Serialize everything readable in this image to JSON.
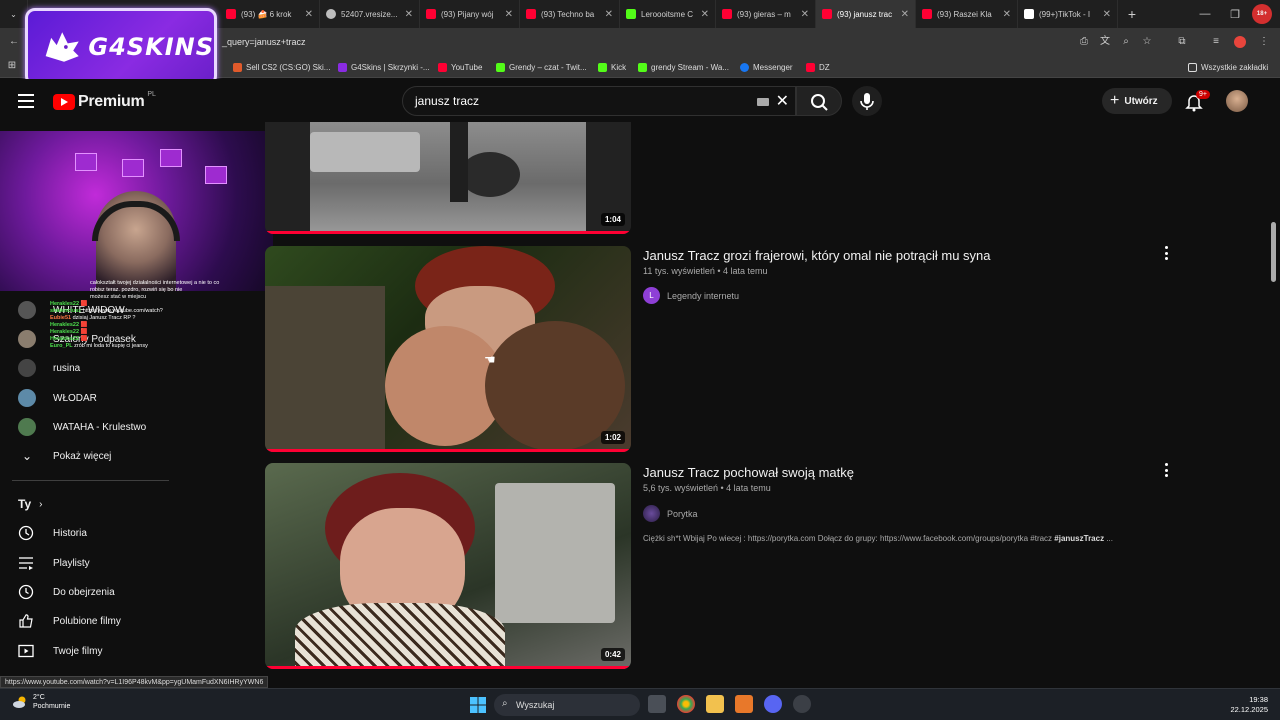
{
  "browser": {
    "tabs": [
      {
        "label": "(93) 🍰 6 krok",
        "color": "#ff0033"
      },
      {
        "label": "52407.vresize...",
        "color": "#bdbdbd"
      },
      {
        "label": "(93) Pijany wój",
        "color": "#ff0033"
      },
      {
        "label": "(93) Techno ba",
        "color": "#ff0033"
      },
      {
        "label": "Leroooitsme C",
        "color": "#53fc18"
      },
      {
        "label": "(93) gieras – m",
        "color": "#ff0033"
      },
      {
        "label": "(93) janusz trac",
        "color": "#ff0033",
        "active": true
      },
      {
        "label": "(93) Raszei Kla",
        "color": "#ff0033"
      },
      {
        "label": "(99+)TikTok - I",
        "color": "#ffffff"
      }
    ],
    "url": "_query=janusz+tracz",
    "bookmarks": [
      {
        "label": "Sell CS2 (CS:GO) Ski...",
        "color": "#e05a2b"
      },
      {
        "label": "G4Skins | Skrzynki -...",
        "color": "#8a2be2"
      },
      {
        "label": "YouTube",
        "color": "#ff0033"
      },
      {
        "label": "Grendy – czat - Twit...",
        "color": "#53fc18"
      },
      {
        "label": "Kick",
        "color": "#53fc18"
      },
      {
        "label": "grendy Stream - Wa...",
        "color": "#53fc18"
      },
      {
        "label": "Messenger",
        "color": "#1877f2"
      },
      {
        "label": "DZ",
        "color": "#ff0033"
      }
    ],
    "all_bookmarks": "Wszystkie zakładki",
    "status_url": "https://www.youtube.com/watch?v=L1I96P48kvM&pp=ygUMamFudXN6IHRyYWN6"
  },
  "overlay": {
    "brand": "G4SKINS",
    "accent": "#8a2be2"
  },
  "youtube": {
    "logo_text": "Premium",
    "logo_region": "PL",
    "search_query": "janusz tracz",
    "create_label": "Utwórz",
    "notifications_badge": "9+",
    "accent": "#ff0000"
  },
  "chat": [
    {
      "user": "",
      "text": "całokształt twojej działalności internetowej a nie to co robisz teraz. pozdro, rozwiń się bo nie"
    },
    {
      "user": "",
      "text": "możesz stać w miejscu"
    },
    {
      "user": "Herakles22",
      "text": "🟥"
    },
    {
      "user": "shalenciusz",
      "text": "https://www.youtube.com/watch?"
    },
    {
      "user": "Eubie51",
      "text": "dzisiaj Janusz Tracz RP ?"
    },
    {
      "user": "Herakles22",
      "text": "🟥"
    },
    {
      "user": "Herakles22",
      "text": "🟥"
    },
    {
      "user": "Herakles22",
      "text": "🟥"
    },
    {
      "user": "Euro_PL",
      "text": "zrób mi loda to kupię ci jeansy"
    }
  ],
  "sidebar": {
    "subscriptions": [
      {
        "label": "WHITE WIDOW",
        "color": "#666"
      },
      {
        "label": "Szalony Podpasek",
        "color": "#8a7d6e"
      },
      {
        "label": "rusina",
        "color": "#555"
      },
      {
        "label": "WŁODAR",
        "color": "#5d8aa8"
      },
      {
        "label": "WATAHA - Krulestwo",
        "color": "#4f7a4f"
      }
    ],
    "show_more": "Pokaż więcej",
    "you_title": "Ty",
    "nav": [
      {
        "label": "Historia",
        "icon": "history-icon"
      },
      {
        "label": "Playlisty",
        "icon": "playlist-icon"
      },
      {
        "label": "Do obejrzenia",
        "icon": "watch-later-icon"
      },
      {
        "label": "Polubione filmy",
        "icon": "like-icon"
      },
      {
        "label": "Twoje filmy",
        "icon": "your-videos-icon"
      }
    ]
  },
  "results": [
    {
      "duration": "1:04"
    },
    {
      "title": "Janusz Tracz grozi frajerowi, który omal nie potrącił mu syna",
      "meta": "11 tys. wyświetleń • 4 lata temu",
      "channel": "Legendy internetu",
      "channel_initial": "L",
      "channel_color": "#8e3fd6",
      "duration": "1:02"
    },
    {
      "title": "Janusz Tracz pochował swoją matkę",
      "meta": "5,6 tys. wyświetleń • 4 lata temu",
      "channel": "Porytka",
      "channel_initial": "",
      "channel_color": "#3b2a5c",
      "description": "Ciężki sh*t Wbijaj Po wiecej : https://porytka.com Dołącz do grupy: https://www.facebook.com/groups/porytka #tracz ",
      "description_tag": "#januszTracz",
      "description_tail": " ...",
      "duration": "0:42"
    }
  ],
  "taskbar": {
    "temperature": "2°C",
    "weather": "Pochmurnie",
    "search_label": "Wyszukaj",
    "time": "19:38",
    "date": "22.12.2025"
  }
}
